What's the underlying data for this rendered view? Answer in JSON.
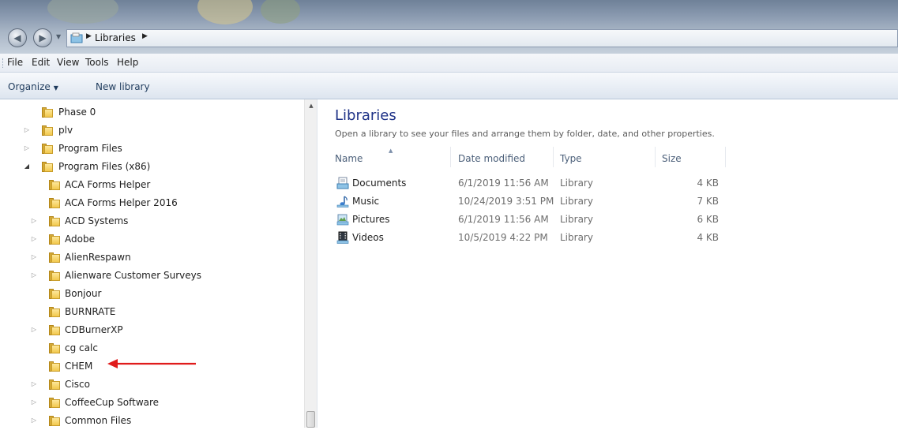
{
  "addressbar": {
    "path": "Libraries"
  },
  "menu": [
    "File",
    "Edit",
    "View",
    "Tools",
    "Help"
  ],
  "commands": {
    "organize": "Organize",
    "new_library": "New library"
  },
  "tree": [
    {
      "label": "Phase 0",
      "expander": "none"
    },
    {
      "label": "plv",
      "expander": "collapsed"
    },
    {
      "label": "Program Files",
      "expander": "collapsed"
    },
    {
      "label": "Program Files (x86)",
      "expander": "expanded"
    },
    {
      "label": "ACA Forms Helper",
      "expander": "none"
    },
    {
      "label": "ACA Forms Helper 2016",
      "expander": "none"
    },
    {
      "label": "ACD Systems",
      "expander": "collapsed"
    },
    {
      "label": "Adobe",
      "expander": "collapsed"
    },
    {
      "label": "AlienRespawn",
      "expander": "collapsed"
    },
    {
      "label": "Alienware Customer Surveys",
      "expander": "collapsed"
    },
    {
      "label": "Bonjour",
      "expander": "none"
    },
    {
      "label": "BURNRATE",
      "expander": "none"
    },
    {
      "label": "CDBurnerXP",
      "expander": "collapsed"
    },
    {
      "label": "cg calc",
      "expander": "none"
    },
    {
      "label": "CHEM",
      "expander": "none"
    },
    {
      "label": "Cisco",
      "expander": "collapsed"
    },
    {
      "label": "CoffeeCup Software",
      "expander": "collapsed"
    },
    {
      "label": "Common Files",
      "expander": "collapsed"
    }
  ],
  "content": {
    "title": "Libraries",
    "subtitle": "Open a library to see your files and arrange them by folder, date, and other properties.",
    "columns": {
      "name": "Name",
      "date": "Date modified",
      "type": "Type",
      "size": "Size"
    },
    "files": [
      {
        "name": "Documents",
        "date": "6/1/2019 11:56 AM",
        "type": "Library",
        "size": "4 KB",
        "icon": "documents-library-icon"
      },
      {
        "name": "Music",
        "date": "10/24/2019 3:51 PM",
        "type": "Library",
        "size": "7 KB",
        "icon": "music-library-icon"
      },
      {
        "name": "Pictures",
        "date": "6/1/2019 11:56 AM",
        "type": "Library",
        "size": "6 KB",
        "icon": "pictures-library-icon"
      },
      {
        "name": "Videos",
        "date": "10/5/2019 4:22 PM",
        "type": "Library",
        "size": "4 KB",
        "icon": "videos-library-icon"
      }
    ]
  },
  "colors": {
    "title": "#1e3287",
    "annotation_arrow": "#e01b1b"
  }
}
